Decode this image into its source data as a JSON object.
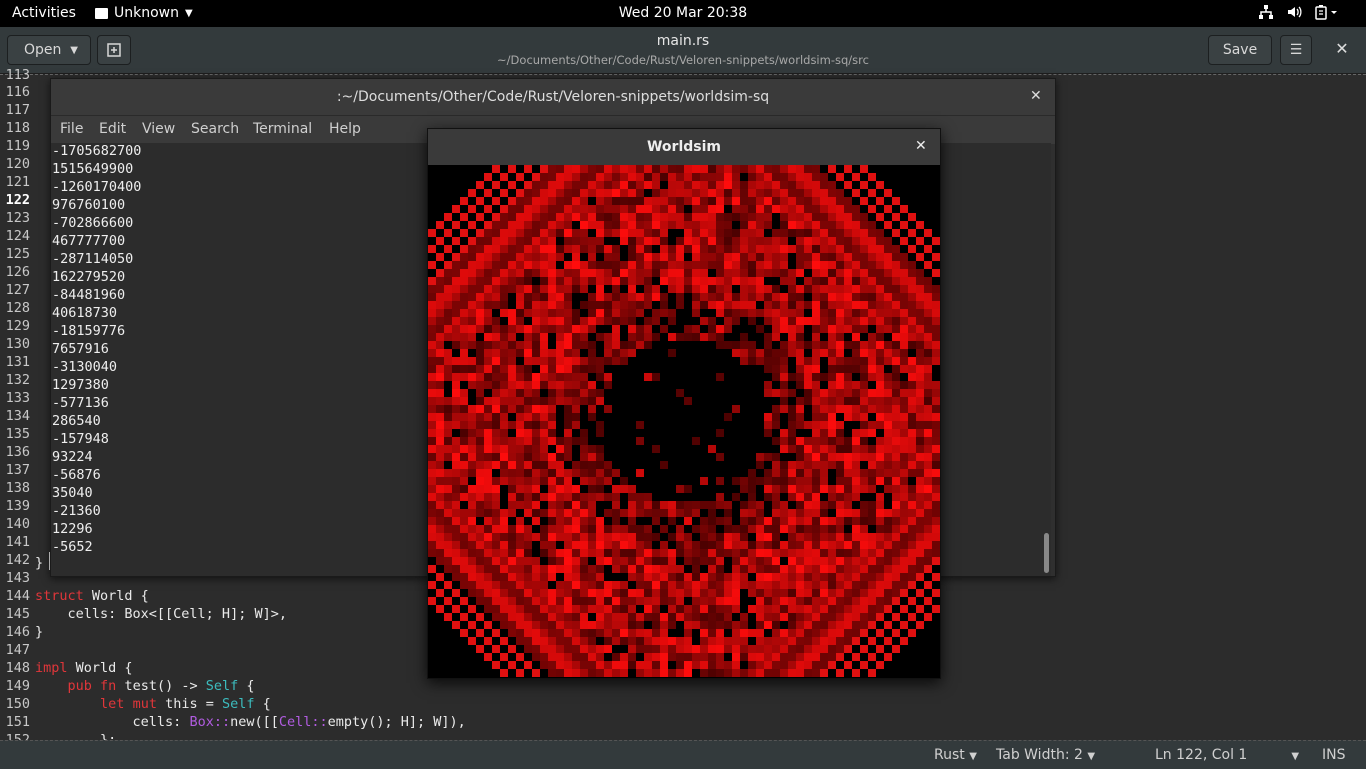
{
  "topbar": {
    "activities": "Activities",
    "app_name": "Unknown",
    "clock": "Wed 20 Mar  20:38"
  },
  "gedit": {
    "open_label": "Open",
    "title": "main.rs",
    "subtitle": "~/Documents/Other/Code/Rust/Veloren-snippets/worldsim-sq/src",
    "save_label": "Save"
  },
  "editor": {
    "top_partial_line": "113",
    "lines_top": [
      "116",
      "117",
      "118"
    ],
    "line_numbers": [
      "119",
      "120",
      "121",
      "122",
      "123",
      "124",
      "125",
      "126",
      "127",
      "128",
      "129",
      "130",
      "131",
      "132",
      "133",
      "134",
      "135",
      "136",
      "137",
      "138",
      "139",
      "140",
      "141",
      "142",
      "143",
      "144",
      "145",
      "146",
      "147",
      "148",
      "149",
      "150",
      "151"
    ],
    "current_line": "122",
    "bottom_partial_line": "152",
    "code_closing_brace": "}",
    "code_144_kw": "struct",
    "code_144_rest": " World {",
    "code_145": "    cells: Box<[[Cell; H]; W]>,",
    "code_146": "}",
    "code_148_kw": "impl",
    "code_148_rest": " World {",
    "code_149_pre": "    ",
    "code_149_kw1": "pub",
    "code_149_kw2": "fn",
    "code_149_mid": " test() -> ",
    "code_149_ty": "Self",
    "code_149_end": " {",
    "code_150_kw1": "let",
    "code_150_kw2": "mut",
    "code_150_mid": " this = ",
    "code_150_ty": "Self",
    "code_150_end": " {",
    "code_151_pre": "            cells: ",
    "code_151_box": "Box::",
    "code_151_mid1": "new([[",
    "code_151_cell": "Cell::",
    "code_151_end": "empty(); H]; W]),",
    "code_152": "        };"
  },
  "terminal": {
    "title": ":~/Documents/Other/Code/Rust/Veloren-snippets/worldsim-sq",
    "menu": [
      "File",
      "Edit",
      "View",
      "Search",
      "Terminal",
      "Help"
    ],
    "output": [
      "-1705682700",
      "1515649900",
      "-1260170400",
      "976760100",
      "-702866600",
      "467777700",
      "-287114050",
      "162279520",
      "-84481960",
      "40618730",
      "-18159776",
      "7657916",
      "-3130040",
      "1297380",
      "-577136",
      "286540",
      "-157948",
      "93224",
      "-56876",
      "35040",
      "-21360",
      "12296",
      "-5652"
    ]
  },
  "worldsim": {
    "title": "Worldsim",
    "grid_cells": 64,
    "colors": {
      "bright": "#ff1a1a",
      "dark": "#3a0000"
    }
  },
  "statusbar": {
    "language": "Rust",
    "tab_width": "Tab Width: 2",
    "position": "Ln 122, Col 1",
    "mode": "INS"
  }
}
